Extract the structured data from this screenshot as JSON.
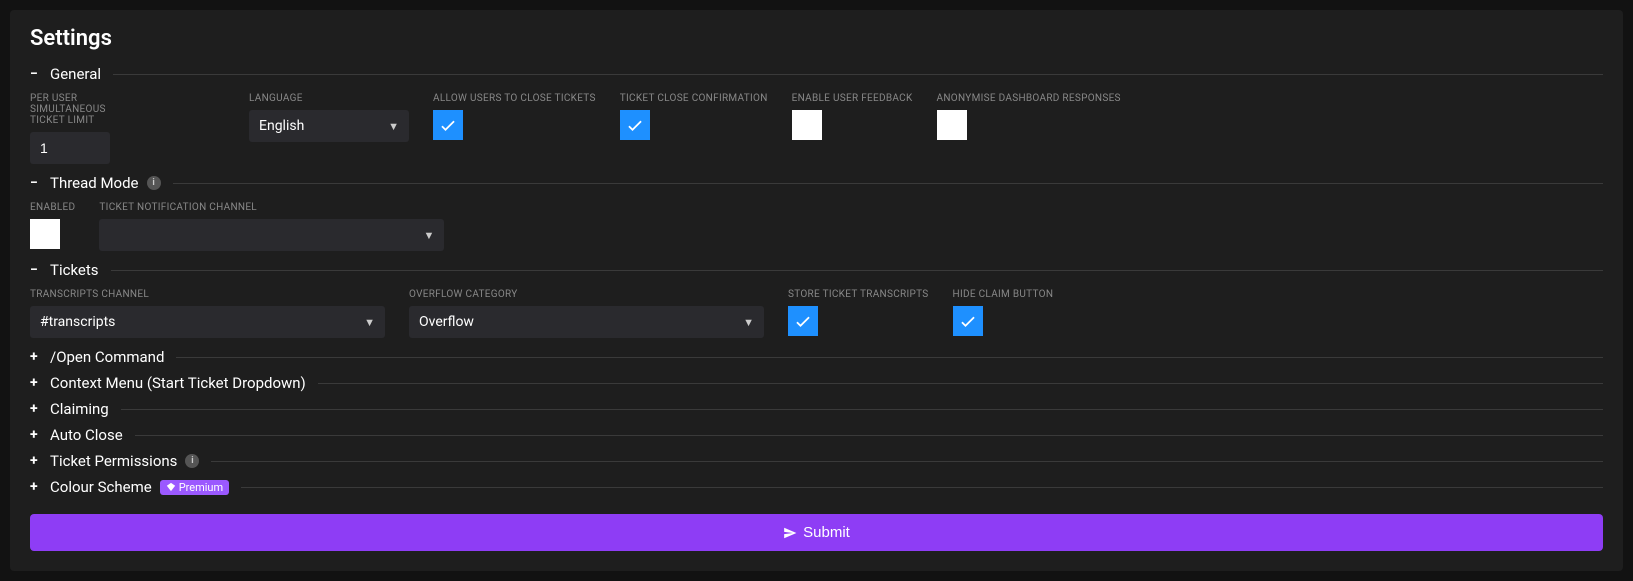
{
  "page_title": "Settings",
  "sections": {
    "general": {
      "title": "General",
      "fields": {
        "per_user_limit_label": "PER USER SIMULTANEOUS TICKET LIMIT",
        "per_user_limit_value": "1",
        "language_label": "LANGUAGE",
        "language_value": "English",
        "allow_close_label": "ALLOW USERS TO CLOSE TICKETS",
        "allow_close_checked": true,
        "close_confirm_label": "TICKET CLOSE CONFIRMATION",
        "close_confirm_checked": true,
        "feedback_label": "ENABLE USER FEEDBACK",
        "feedback_checked": false,
        "anon_label": "ANONYMISE DASHBOARD RESPONSES",
        "anon_checked": false
      }
    },
    "thread_mode": {
      "title": "Thread Mode",
      "fields": {
        "enabled_label": "ENABLED",
        "enabled_checked": false,
        "notif_channel_label": "TICKET NOTIFICATION CHANNEL",
        "notif_channel_value": ""
      }
    },
    "tickets": {
      "title": "Tickets",
      "fields": {
        "transcripts_channel_label": "TRANSCRIPTS CHANNEL",
        "transcripts_channel_value": "#transcripts",
        "overflow_label": "OVERFLOW CATEGORY",
        "overflow_value": "Overflow",
        "store_transcripts_label": "STORE TICKET TRANSCRIPTS",
        "store_transcripts_checked": true,
        "hide_claim_label": "HIDE CLAIM BUTTON",
        "hide_claim_checked": true
      }
    },
    "open_command": {
      "title": "/Open Command"
    },
    "context_menu": {
      "title": "Context Menu (Start Ticket Dropdown)"
    },
    "claiming": {
      "title": "Claiming"
    },
    "auto_close": {
      "title": "Auto Close"
    },
    "ticket_permissions": {
      "title": "Ticket Permissions"
    },
    "colour_scheme": {
      "title": "Colour Scheme",
      "badge": "Premium"
    }
  },
  "submit_label": "Submit"
}
